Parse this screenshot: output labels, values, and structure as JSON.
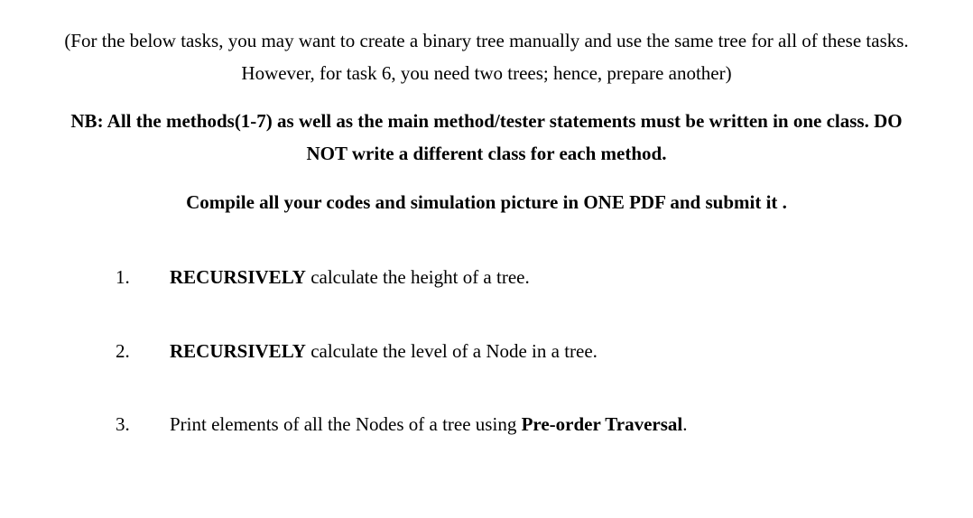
{
  "intro": {
    "text": "(For the below tasks, you may want to create a binary tree manually and use the same tree for all of these tasks. However, for task 6, you need two trees; hence, prepare another)"
  },
  "nb": {
    "text": "NB: All the methods(1-7) as well as the main method/tester statements must be written in one class. DO NOT write a different class for each method."
  },
  "compile": {
    "text": "Compile all your codes and simulation picture in ONE PDF and submit it ."
  },
  "tasks": [
    {
      "number": "1.",
      "bold": "RECURSIVELY",
      "rest": " calculate the height of a tree."
    },
    {
      "number": "2.",
      "bold": "RECURSIVELY",
      "rest": " calculate the level of a Node in a tree."
    },
    {
      "number": "3.",
      "prefix": "Print elements of all the Nodes of a tree using ",
      "bold2": "Pre-order Traversal",
      "suffix": "."
    }
  ]
}
